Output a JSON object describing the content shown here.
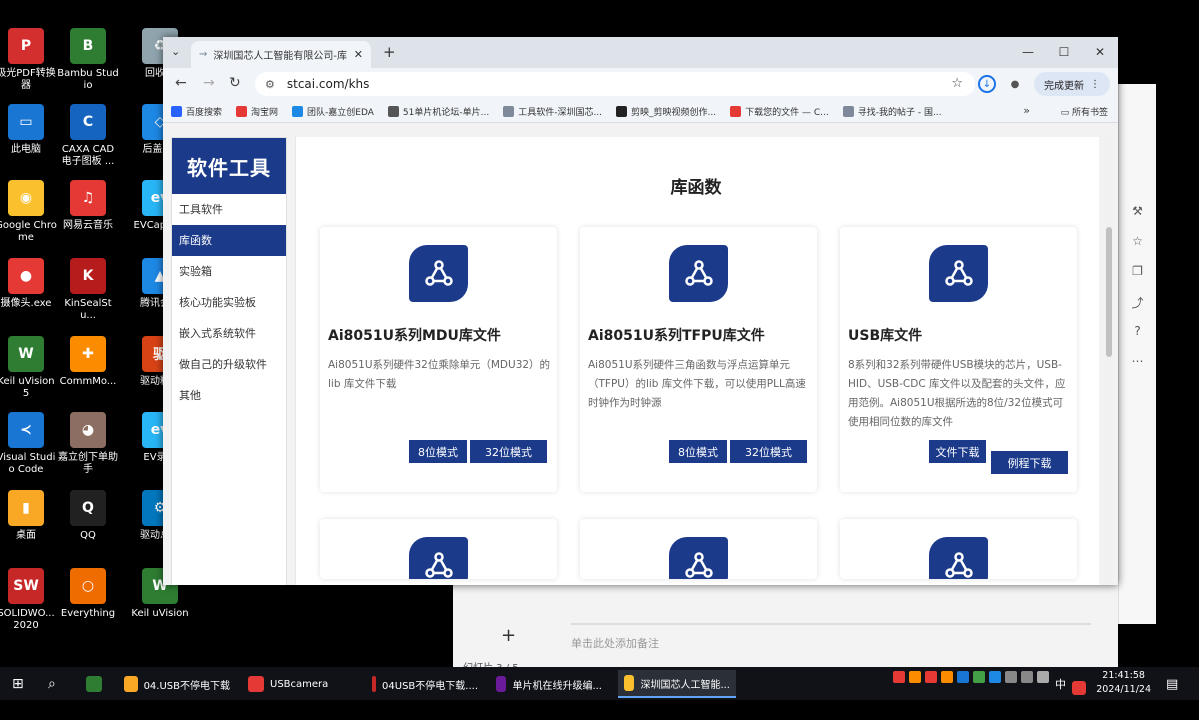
{
  "desktop": {
    "icons": [
      {
        "label": "极光PDF转换器",
        "color": "#d32f2f",
        "glyph": "P"
      },
      {
        "label": "Bambu Studio",
        "color": "#2e7d32",
        "glyph": "B"
      },
      {
        "label": "回收站",
        "color": "#90a4ae",
        "glyph": "♻"
      },
      {
        "label": "此电脑",
        "color": "#1976d2",
        "glyph": "▭"
      },
      {
        "label": "CAXA CAD 电子图板 ...",
        "color": "#1565c0",
        "glyph": "C"
      },
      {
        "label": "后盖.stl",
        "color": "#1e88e5",
        "glyph": "◇"
      },
      {
        "label": "Google Chrome",
        "color": "#fbc02d",
        "glyph": "◉"
      },
      {
        "label": "网易云音乐",
        "color": "#e53935",
        "glyph": "♫"
      },
      {
        "label": "EVCapture",
        "color": "#29b6f6",
        "glyph": "ev"
      },
      {
        "label": "摄像头.exe",
        "color": "#e53935",
        "glyph": "●"
      },
      {
        "label": "KinSealStu...",
        "color": "#b71c1c",
        "glyph": "K"
      },
      {
        "label": "腾讯会议",
        "color": "#1e88e5",
        "glyph": "▲"
      },
      {
        "label": "Keil uVision5",
        "color": "#2e7d32",
        "glyph": "W"
      },
      {
        "label": "CommMo...",
        "color": "#fb8c00",
        "glyph": "✚"
      },
      {
        "label": "驱动精灵",
        "color": "#d84315",
        "glyph": "驱"
      },
      {
        "label": "Visual Studio Code",
        "color": "#1976d2",
        "glyph": "≺"
      },
      {
        "label": "嘉立创下单助手",
        "color": "#8d6e63",
        "glyph": "◕"
      },
      {
        "label": "EV录屏",
        "color": "#29b6f6",
        "glyph": "ev"
      },
      {
        "label": "桌面",
        "color": "#f9a825",
        "glyph": "▮"
      },
      {
        "label": "QQ",
        "color": "#212121",
        "glyph": "Q"
      },
      {
        "label": "驱动总裁",
        "color": "#0277bd",
        "glyph": "⚙"
      },
      {
        "label": "SOLIDWO... 2020",
        "color": "#c62828",
        "glyph": "SW"
      },
      {
        "label": "Everything",
        "color": "#ef6c00",
        "glyph": "○"
      },
      {
        "label": "Keil uVision",
        "color": "#2e7d32",
        "glyph": "W"
      }
    ]
  },
  "browser": {
    "tab_title": "深圳国芯人工智能有限公司-库...",
    "url": "stcai.com/khs",
    "update_label": "完成更新",
    "bookmarks": [
      {
        "label": "百度搜索",
        "color": "#2962ff"
      },
      {
        "label": "淘宝网",
        "color": "#e53935"
      },
      {
        "label": "团队-嘉立创EDA",
        "color": "#1e88e5"
      },
      {
        "label": "51单片机论坛-单片...",
        "color": "#555555"
      },
      {
        "label": "工具软件-深圳国芯...",
        "color": "#7e8a9a"
      },
      {
        "label": "剪映_剪映视频创作...",
        "color": "#222222"
      },
      {
        "label": "下载您的文件 — C...",
        "color": "#e53935"
      },
      {
        "label": "寻找-我的帖子 - 国...",
        "color": "#7e8a9a"
      }
    ],
    "all_bookmarks_label": "所有书签"
  },
  "page": {
    "brand": "软件工具",
    "nav": [
      "工具软件",
      "库函数",
      "实验箱",
      "核心功能实验板",
      "嵌入式系统软件",
      "做自己的升级软件",
      "其他"
    ],
    "active_nav": 1,
    "title": "库函数",
    "cards": [
      {
        "title": "Ai8051U系列MDU库文件",
        "desc": "Ai8051U系列硬件32位乘除单元（MDU32）的lib 库文件下载",
        "buttons": [
          "8位模式",
          "32位模式"
        ]
      },
      {
        "title": "Ai8051U系列TFPU库文件",
        "desc": "Ai8051U系列硬件三角函数与浮点运算单元（TFPU）的lib 库文件下载，可以使用PLL高速时钟作为时钟源",
        "buttons": [
          "8位模式",
          "32位模式"
        ]
      },
      {
        "title": "USB库文件",
        "desc": "8系列和32系列带硬件USB模块的芯片，USB-HID、USB-CDC 库文件以及配套的头文件，应用范例。Ai8051U根据所选的8位/32位模式可使用相同位数的库文件",
        "buttons": [
          "文件下载",
          "例程下载"
        ]
      }
    ]
  },
  "background_app": {
    "note_placeholder": "单击此处添加备注",
    "status": "幻灯片 3 / 5"
  },
  "taskbar": {
    "items": [
      {
        "label": "04.USB不停电下载",
        "color": "#f9a825"
      },
      {
        "label": "USBcamera",
        "color": "#e53935"
      },
      {
        "label": "04USB不停电下载....",
        "color": "#c62828"
      },
      {
        "label": "单片机在线升级编...",
        "color": "#6a1b9a"
      },
      {
        "label": "深圳国芯人工智能...",
        "color": "#fbc02d"
      }
    ],
    "ime": "中",
    "time": "21:41:58",
    "date": "2024/11/24"
  }
}
